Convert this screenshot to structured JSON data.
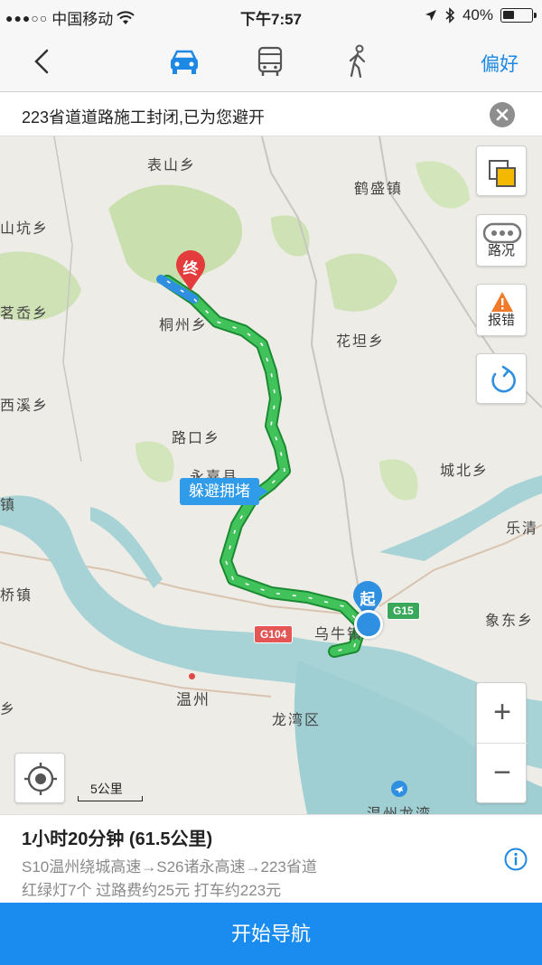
{
  "status_bar": {
    "signal": "●●●○○",
    "carrier": "中国移动",
    "time": "下午7:57",
    "battery": "40%",
    "battery_level": 0.4
  },
  "navbar": {
    "modes": [
      "car-icon",
      "bus-icon",
      "walk-icon"
    ],
    "active_mode": "car",
    "preference_label": "偏好",
    "accent_color": "#1e88e5"
  },
  "notice": {
    "text": "223省道道路施工封闭,已为您避开"
  },
  "map": {
    "places": {
      "biaoshan": "表山乡",
      "heshengzhen": "鹤盛镇",
      "shankeng": "山坑乡",
      "mingxi": "茗岙乡",
      "tongzhou": "桐州乡",
      "huatan": "花坦乡",
      "xixi": "西溪乡",
      "lukou": "路口乡",
      "yongjia": "永嘉县",
      "chengbei": "城北乡",
      "yueqing": "乐清",
      "qiaozhen": "桥镇",
      "wuniu": "乌牛镇",
      "xiangdong": "象东乡",
      "wenzhou": "温州",
      "longwan": "龙湾区",
      "airport": "温州龙湾",
      "jiezhen": "镇",
      "ang": "乡"
    },
    "route_bubble": "躲避拥堵",
    "end_marker": "终",
    "start_marker": "起",
    "road_tags": {
      "g15": "G15",
      "g104": "G104"
    },
    "buttons": {
      "layers": "",
      "traffic": "路况",
      "report": "报错",
      "refresh": "",
      "zoom_in": "+",
      "zoom_out": "−"
    },
    "scale": "5公里",
    "route_color": "#2db34a"
  },
  "info": {
    "summary": "1小时20分钟 (61.5公里)",
    "route": "S10温州绕城高速→S26诸永高速→223省道",
    "costs": "红绿灯7个  过路费约25元  打车约223元"
  },
  "start_button": "开始导航"
}
